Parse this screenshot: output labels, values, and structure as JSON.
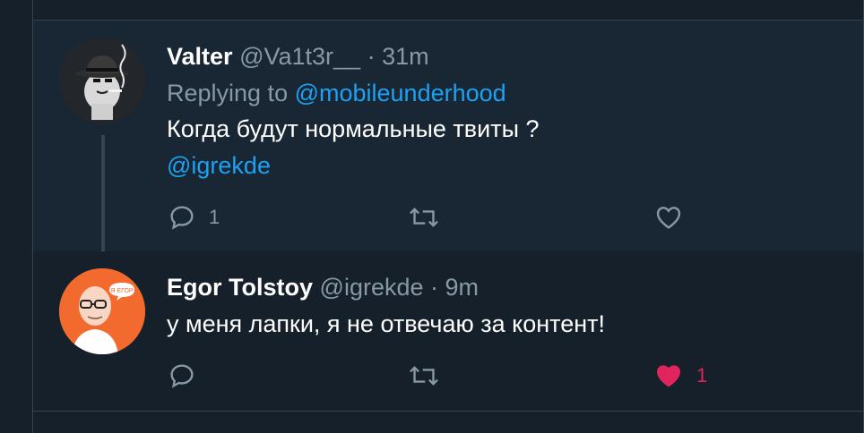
{
  "tweets": [
    {
      "name": "Valter",
      "handle": "@Va1t3r__",
      "sep": "·",
      "time": "31m",
      "replying_prefix": "Replying to ",
      "replying_handle": "@mobileunderhood",
      "text_line1": "Когда будут нормальные твиты ?",
      "text_line2": "@igrekde",
      "reply_count": "1",
      "retweet_count": "",
      "like_count": "",
      "liked": false,
      "avatar_icon": "cat-fedora-avatar-icon"
    },
    {
      "name": "Egor Tolstoy",
      "handle": "@igrekde",
      "sep": "·",
      "time": "9m",
      "text_line1": "у меня лапки, я не отвечаю за контент!",
      "reply_count": "",
      "retweet_count": "",
      "like_count": "1",
      "liked": true,
      "avatar_icon": "bald-man-glasses-avatar-icon",
      "avatar_bubble_text": "Я ЕГОР"
    }
  ],
  "colors": {
    "background": "#15202b",
    "highlight_background": "#192734",
    "border": "#38444d",
    "muted_text": "#8899a6",
    "link": "#1da1f2",
    "like_active": "#e0245e"
  }
}
